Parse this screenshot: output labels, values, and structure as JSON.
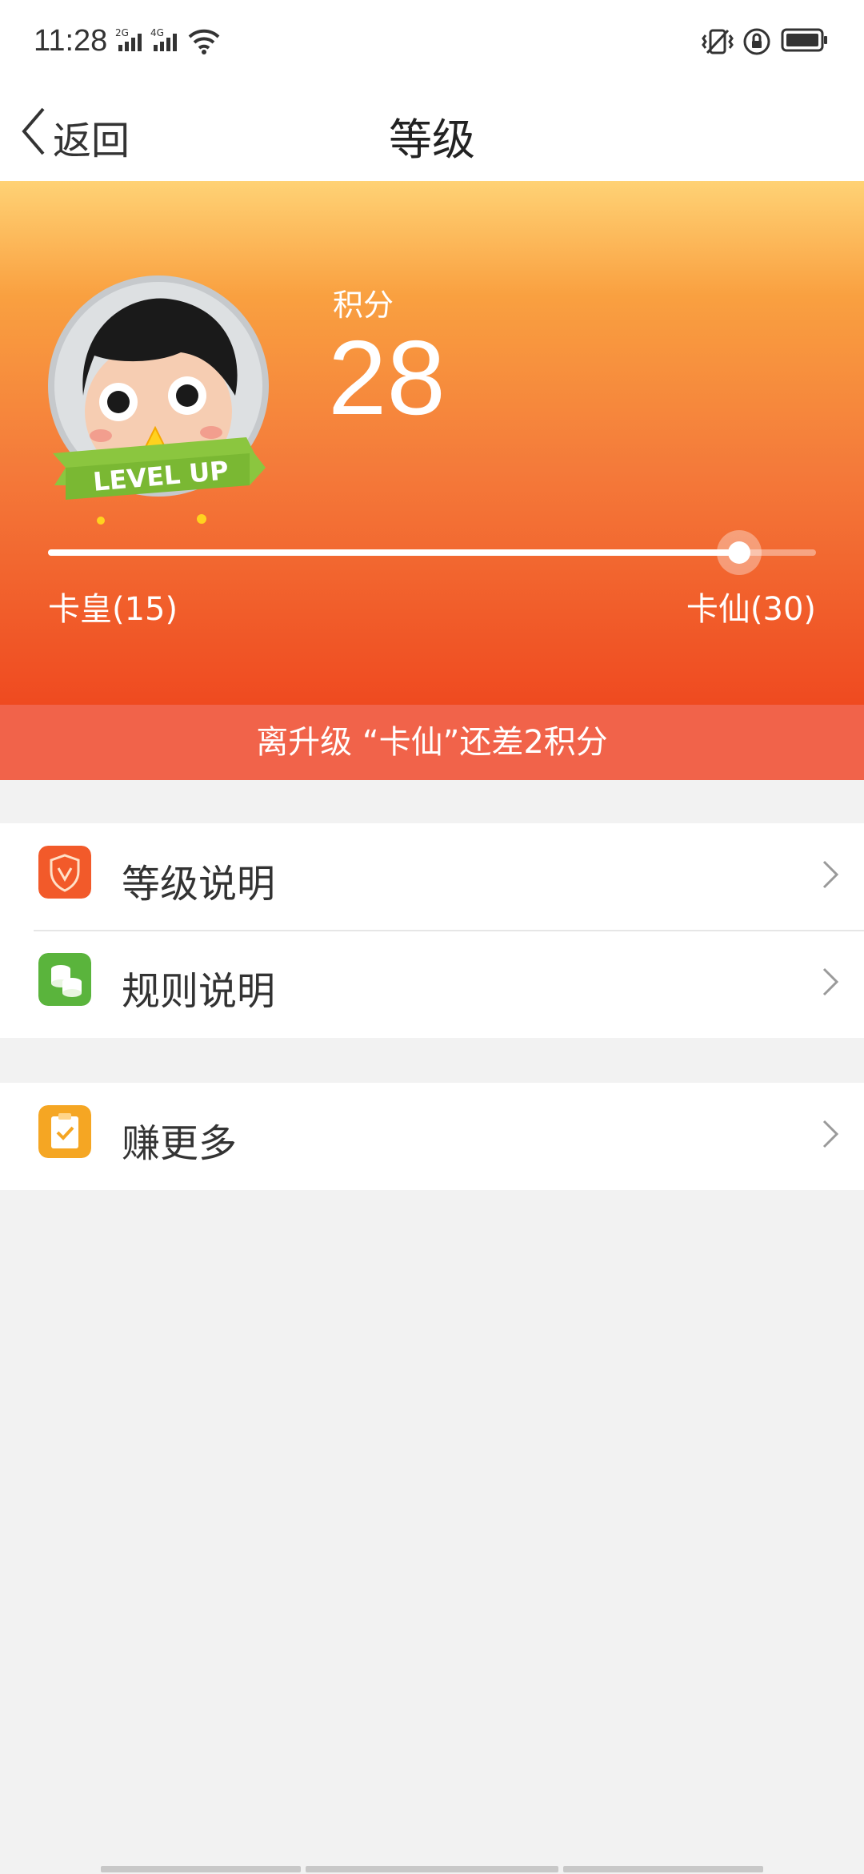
{
  "status_bar": {
    "time": "11:28",
    "network_2g": "2G",
    "network_4g": "4G",
    "icons": [
      "signal-2g-icon",
      "signal-4g-icon",
      "wifi-icon",
      "vibrate-icon",
      "rotation-lock-icon",
      "battery-icon"
    ]
  },
  "nav": {
    "back_label": "返回",
    "title": "等级"
  },
  "hero": {
    "badge_text": "LEVEL UP",
    "points_label": "积分",
    "points_value": "28",
    "current_level": "卡皇(15)",
    "next_level": "卡仙(30)",
    "progress_fraction": 0.9
  },
  "notice": "离升级 “卡仙”还差2积分",
  "menu": {
    "level_info": {
      "label": "等级说明",
      "icon": "shield-v-icon",
      "color": "#f25a2a"
    },
    "rules_info": {
      "label": "规则说明",
      "icon": "coins-stack-icon",
      "color": "#5ab43c"
    },
    "earn_more": {
      "label": "赚更多",
      "icon": "clipboard-check-icon",
      "color": "#f5a623"
    }
  }
}
